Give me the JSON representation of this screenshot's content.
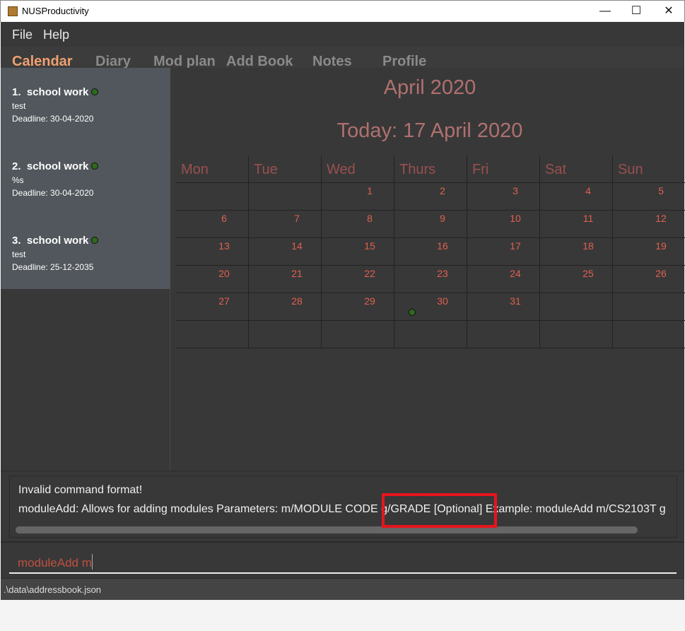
{
  "window": {
    "title": "NUSProductivity",
    "icon": "app-icon"
  },
  "menu": [
    "File",
    "Help"
  ],
  "tabs": [
    {
      "label": "Calendar",
      "active": true
    },
    {
      "label": "Diary"
    },
    {
      "label": "Mod plan"
    },
    {
      "label": "Add Book"
    },
    {
      "label": "Notes"
    },
    {
      "label": "Profile"
    }
  ],
  "deadlines": [
    {
      "index": "1.",
      "title": "school work",
      "desc": "test",
      "deadline": "Deadline: 30-04-2020"
    },
    {
      "index": "2.",
      "title": "school work",
      "desc": "%s",
      "deadline": "Deadline: 30-04-2020"
    },
    {
      "index": "3.",
      "title": "school work",
      "desc": "test",
      "deadline": "Deadline: 25-12-2035"
    }
  ],
  "calendar": {
    "month": "April 2020",
    "today": "Today: 17 April 2020",
    "days": [
      "Mon",
      "Tue",
      "Wed",
      "Thurs",
      "Fri",
      "Sat",
      "Sun"
    ],
    "weeks": [
      [
        "",
        "",
        "1",
        "2",
        "3",
        "4",
        "5"
      ],
      [
        "6",
        "7",
        "8",
        "9",
        "10",
        "11",
        "12"
      ],
      [
        "13",
        "14",
        "15",
        "16",
        "17",
        "18",
        "19"
      ],
      [
        "20",
        "21",
        "22",
        "23",
        "24",
        "25",
        "26"
      ],
      [
        "27",
        "28",
        "29",
        "30",
        "31",
        "",
        ""
      ],
      [
        "",
        "",
        "",
        "",
        "",
        "",
        ""
      ]
    ],
    "event_dates": [
      "30"
    ],
    "colors": {
      "title": "#b07070",
      "date": "#e06050",
      "event_dot": "#2d6a1a"
    }
  },
  "result": {
    "line1": "Invalid command format!",
    "line2": "moduleAdd: Allows for adding modules Parameters: m/MODULE CODE g/GRADE [Optional] Example: moduleAdd m/CS2103T g"
  },
  "command": {
    "value": "moduleAdd m"
  },
  "status": {
    "path": ".\\data\\addressbook.json"
  }
}
